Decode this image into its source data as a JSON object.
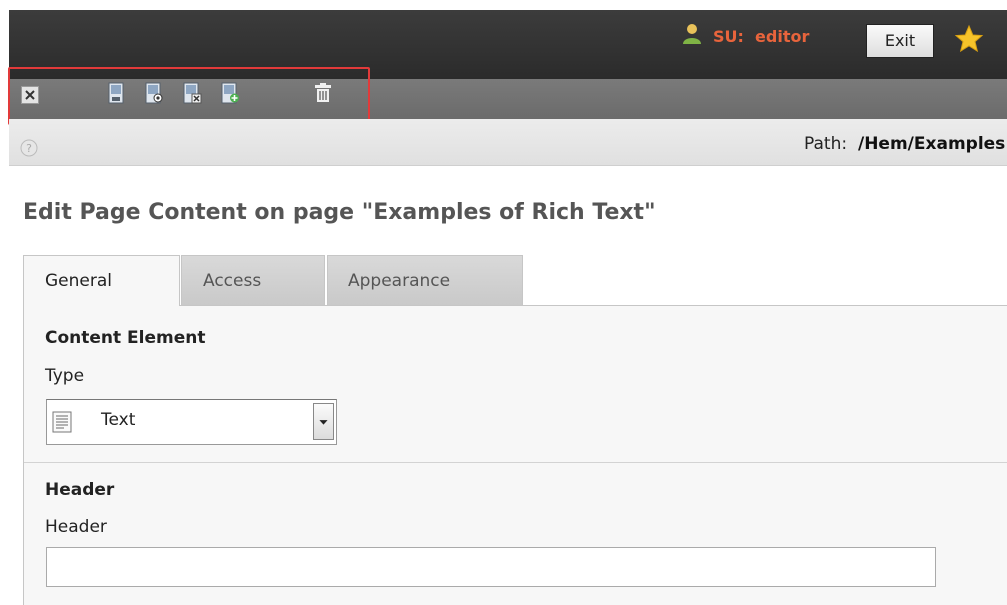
{
  "topbar": {
    "user_label": "SU:  editor",
    "exit_label": "Exit"
  },
  "toolbar": {
    "icons": [
      "close-icon",
      "save-icon",
      "save-and-view-icon",
      "save-and-close-icon",
      "save-and-new-icon",
      "delete-icon"
    ]
  },
  "pathbar": {
    "path_label": "Path:",
    "path_value": "/Hem/Examples of Rich Text/"
  },
  "page": {
    "title": "Edit Page Content on page \"Examples of Rich Text\""
  },
  "tabs": [
    {
      "label": "General",
      "active": true
    },
    {
      "label": "Access",
      "active": false
    },
    {
      "label": "Appearance",
      "active": false
    }
  ],
  "form": {
    "content_element_heading": "Content Element",
    "type_label": "Type",
    "type_value": "Text",
    "header_heading": "Header",
    "header_label": "Header",
    "header_value": ""
  },
  "colors": {
    "accent": "#e8643c",
    "highlight": "#e23a3a",
    "topbar": "#333333",
    "toolbar": "#707070"
  }
}
